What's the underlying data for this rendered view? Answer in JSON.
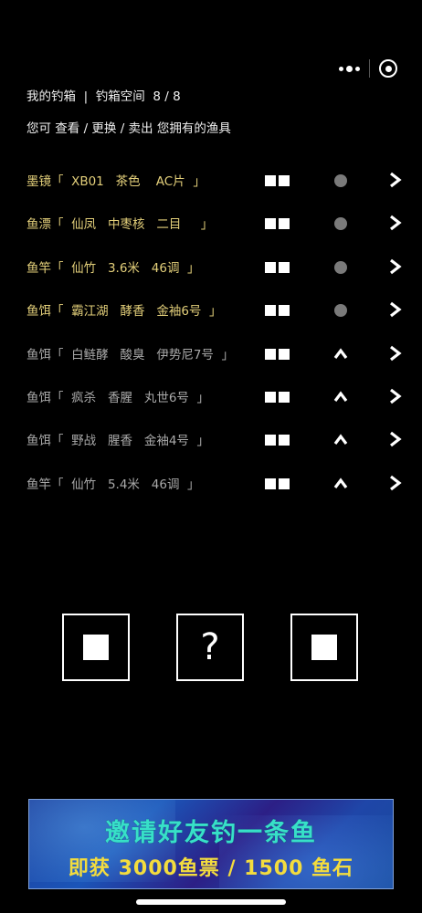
{
  "header": {
    "box_title": "我的钓箱",
    "separator": "|",
    "capacity_label": "钓箱空间",
    "capacity_value": "8 / 8"
  },
  "subheader": "您可 查看 / 更换 / 卖出 您拥有的渔具",
  "items": [
    {
      "category": "墨镜",
      "detail": "「  XB01   茶色    AC片  」",
      "equipped": true
    },
    {
      "category": "鱼漂",
      "detail": "「  仙凤   中枣核   二目     」",
      "equipped": true
    },
    {
      "category": "鱼竿",
      "detail": "「  仙竹   3.6米   46调  」",
      "equipped": true
    },
    {
      "category": "鱼饵",
      "detail": "「  霸江湖   酵香   金袖6号  」",
      "equipped": true
    },
    {
      "category": "鱼饵",
      "detail": "「  白鲢酵   酸臭   伊势尼7号  」",
      "equipped": false
    },
    {
      "category": "鱼饵",
      "detail": "「  疯杀   香腥   丸世6号  」",
      "equipped": false
    },
    {
      "category": "鱼饵",
      "detail": "「  野战   腥香   金袖4号  」",
      "equipped": false
    },
    {
      "category": "鱼竿",
      "detail": "「  仙竹   5.4米   46调  」",
      "equipped": false
    }
  ],
  "actions": {
    "help_label": "?"
  },
  "banner": {
    "line1": "邀请好友钓一条鱼",
    "line2": "即获 3000鱼票 / 1500 鱼石"
  },
  "colors": {
    "equipped_text": "#e3cf7a",
    "unequipped_text": "#a9a9a9",
    "banner_line1": "#37e0c8",
    "banner_line2": "#f3dc3e"
  }
}
